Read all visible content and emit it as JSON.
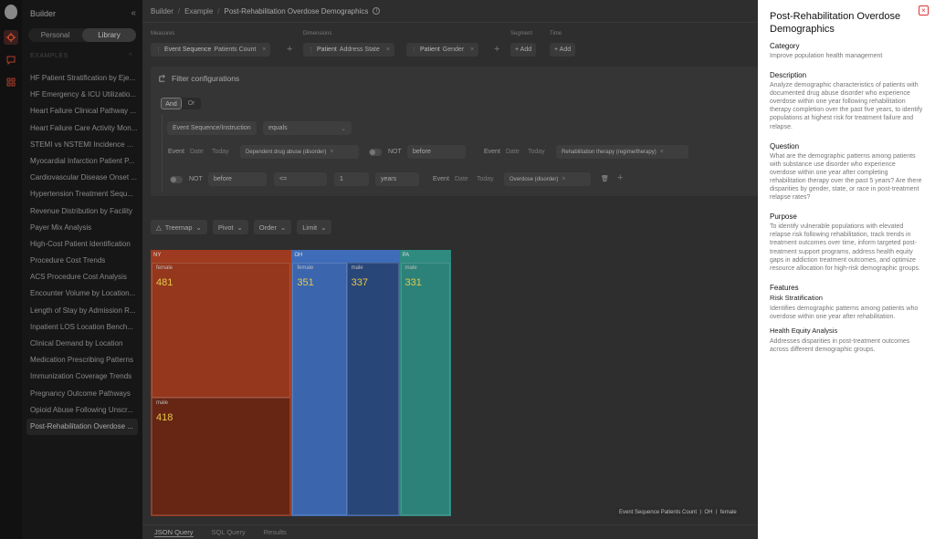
{
  "sidebar": {
    "title": "Builder",
    "collapse_glyph": "«",
    "tabs": [
      "Personal",
      "Library"
    ],
    "section_label": "EXAMPLES",
    "section_glyph": "^",
    "items": [
      "HF Patient Stratification by Eje...",
      "HF Emergency & ICU Utilizatio...",
      "Heart Failure Clinical Pathway ...",
      "Heart Failure Care Activity Mon...",
      "STEMI vs NSTEMI Incidence Tr...",
      "Myocardial Infarction Patient P...",
      "Cardiovascular Disease Onset ...",
      "Hypertension Treatment Sequ...",
      "Revenue Distribution by Facility",
      "Payer Mix Analysis",
      "High-Cost Patient Identification",
      "Procedure Cost Trends",
      "ACS Procedure Cost Analysis",
      "Encounter Volume by Location...",
      "Length of Stay by Admission R...",
      "Inpatient LOS Location Bench...",
      "Clinical Demand by Location",
      "Medication Prescribing Patterns",
      "Immunization Coverage Trends",
      "Pregnancy Outcome Pathways",
      "Opioid Abuse Following Unscr...",
      "Post-Rehabilitation Overdose ..."
    ]
  },
  "breadcrumb": {
    "items": [
      "Builder",
      "Example",
      "Post-Rehabilitation Overdose Demographics"
    ],
    "separator": "/",
    "info_glyph": "i"
  },
  "query": {
    "measures_label": "Measures",
    "dimensions_label": "Dimensions",
    "segment_label": "Segment",
    "time_label": "Time",
    "measure_chip": {
      "bold": "Event Sequence",
      "text": "Patients Count"
    },
    "dimension_chips": [
      {
        "bold": "Patient",
        "text": "Address State"
      },
      {
        "bold": "Patient",
        "text": "Gender"
      }
    ],
    "add_label": "+ Add",
    "plus_glyph": "+",
    "remove_glyph": "×",
    "grip_glyph": "⋮"
  },
  "filter": {
    "title": "Filter configurations",
    "and_label": "And",
    "or_label": "Or",
    "field": "Event Sequence/Instruction",
    "operator": "equals",
    "event_label": "Event",
    "date_label": "Date",
    "today_label": "Today",
    "event1": "Dependent drug abuse (disorder)",
    "not_label": "NOT",
    "before": "before",
    "event2": "Rehabilitation therapy (regime/therapy)",
    "lte": "<=",
    "num": "1",
    "years": "years",
    "event3": "Overdose (disorder)"
  },
  "toolbar": {
    "treemap": "Treemap",
    "pivot": "Pivot",
    "order": "Order",
    "limit": "Limit"
  },
  "chart_data": {
    "type": "treemap",
    "groups": [
      {
        "name": "NY",
        "children": [
          {
            "name": "female",
            "value": 481
          },
          {
            "name": "male",
            "value": 418
          }
        ]
      },
      {
        "name": "OH",
        "children": [
          {
            "name": "female",
            "value": 351
          },
          {
            "name": "male",
            "value": 337
          }
        ]
      },
      {
        "name": "PA",
        "children": [
          {
            "name": "male",
            "value": 331
          }
        ]
      }
    ],
    "colors": {
      "NY": "#9e3a1f",
      "OH": "#3f6cb8",
      "PA": "#2f8a80"
    }
  },
  "tooltip": [
    "Event Sequence Patients Count",
    "OH",
    "female"
  ],
  "bottom_tabs": [
    "JSON Query",
    "SQL Query",
    "Results"
  ],
  "panel": {
    "title": "Post-Rehabilitation Overdose Demographics",
    "close_glyph": "×",
    "category_label": "Category",
    "category": "Improve population health management",
    "description_label": "Description",
    "description": "Analyze demographic characteristics of patients with documented drug abuse disorder who experience overdose within one year following rehabilitation therapy completion over the past five years, to identify populations at highest risk for treatment failure and relapse.",
    "question_label": "Question",
    "question": "What are the demographic patterns among patients with substance use disorder who experience overdose within one year after completing rehabilitation therapy over the past 5 years? Are there disparities by gender, state, or race in post-treatment relapse rates?",
    "purpose_label": "Purpose",
    "purpose": "To identify vulnerable populations with elevated relapse risk following rehabilitation, track trends in treatment outcomes over time, inform targeted post-treatment support programs, address health equity gaps in addiction treatment outcomes, and optimize resource allocation for high-risk demographic groups.",
    "features_label": "Features",
    "features": [
      {
        "title": "Risk Stratification",
        "text": "Identifies demographic patterns among patients who overdose within one year after rehabilitation."
      },
      {
        "title": "Health Equity Analysis",
        "text": "Addresses disparities in post-treatment outcomes across different demographic groups."
      }
    ]
  }
}
